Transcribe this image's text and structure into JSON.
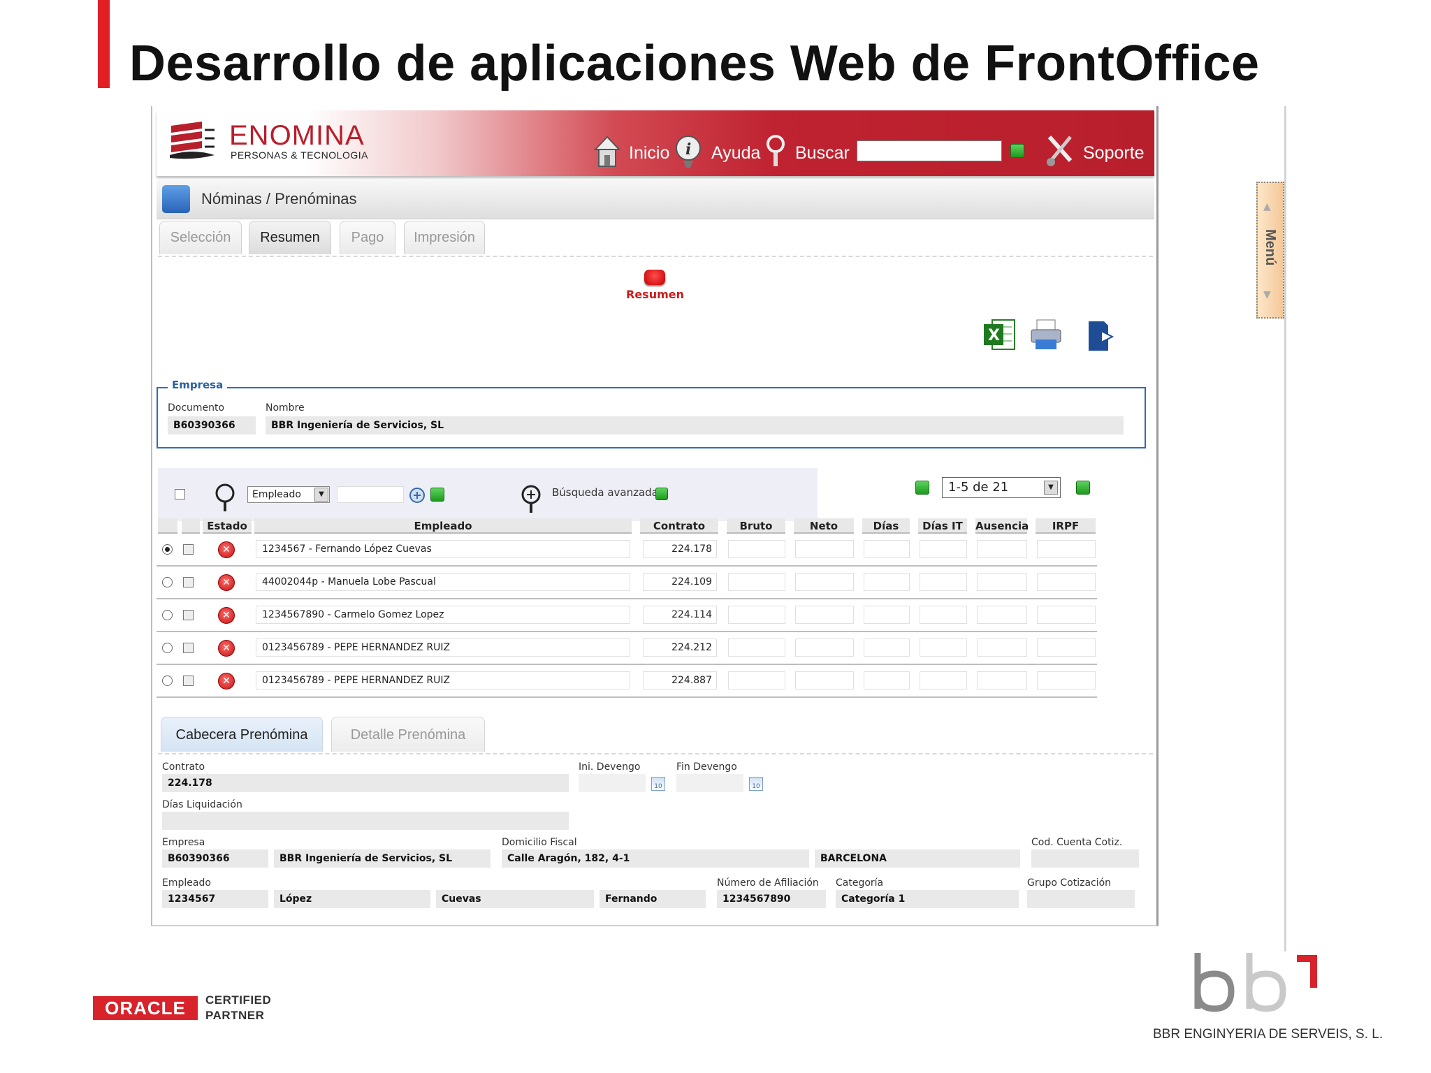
{
  "slide": {
    "title": "Desarrollo de aplicaciones Web de FrontOffice"
  },
  "brand": {
    "name": "ENOMINA",
    "tagline": "PERSONAS & TECNOLOGIA"
  },
  "nav": {
    "inicio": "Inicio",
    "ayuda": "Ayuda",
    "buscar": "Buscar",
    "soporte": "Soporte",
    "search_value": ""
  },
  "breadcrumb": "Nóminas / Prenóminas",
  "tabs": [
    {
      "label": "Selección"
    },
    {
      "label": "Resumen",
      "active": true
    },
    {
      "label": "Pago"
    },
    {
      "label": "Impresión"
    }
  ],
  "summary": {
    "label": "Resumen"
  },
  "toolbar_icons": [
    "excel-icon",
    "print-icon",
    "export-icon"
  ],
  "empresa": {
    "legend": "Empresa",
    "documento_label": "Documento",
    "documento": "B60390366",
    "nombre_label": "Nombre",
    "nombre": "BBR Ingeniería de Servicios, SL"
  },
  "search": {
    "field": "Empleado",
    "value": "",
    "advanced_label": "Búsqueda avanzada"
  },
  "pager": {
    "label": "1-5 de 21"
  },
  "table": {
    "headers": [
      "Estado",
      "Empleado",
      "Contrato",
      "Bruto",
      "Neto",
      "Días",
      "Días IT",
      "Ausencia",
      "IRPF"
    ],
    "rows": [
      {
        "selected": true,
        "empleado": "1234567 - Fernando López Cuevas",
        "contrato": "224.178"
      },
      {
        "selected": false,
        "empleado": "44002044p - Manuela Lobe  Pascual",
        "contrato": "224.109"
      },
      {
        "selected": false,
        "empleado": "1234567890 - Carmelo Gomez Lopez",
        "contrato": "224.114"
      },
      {
        "selected": false,
        "empleado": "0123456789 - PEPE HERNANDEZ RUIZ",
        "contrato": "224.212"
      },
      {
        "selected": false,
        "empleado": "0123456789 - PEPE HERNANDEZ RUIZ",
        "contrato": "224.887"
      }
    ]
  },
  "bottom_tabs": [
    {
      "label": "Cabecera Prenómina",
      "active": true
    },
    {
      "label": "Detalle Prenómina"
    }
  ],
  "cabecera": {
    "contrato_label": "Contrato",
    "contrato": "224.178",
    "ini_devengo_label": "Ini. Devengo",
    "ini_devengo": "",
    "fin_devengo_label": "Fin Devengo",
    "fin_devengo": "",
    "dias_liquidacion_label": "Días Liquidación",
    "dias_liquidacion": "",
    "empresa_label": "Empresa",
    "empresa_cif": "B60390366",
    "empresa_nombre": "BBR Ingeniería de Servicios, SL",
    "domicilio_label": "Domicilio Fiscal",
    "domicilio": "Calle Aragón, 182, 4-1",
    "ciudad": "BARCELONA",
    "cod_cuenta_label": "Cod. Cuenta Cotiz.",
    "cod_cuenta": "",
    "empleado_label": "Empleado",
    "empleado_id": "1234567",
    "apellido1": "López",
    "apellido2": "Cuevas",
    "nombre": "Fernando",
    "afiliacion_label": "Número de Afiliación",
    "afiliacion": "1234567890",
    "categoria_label": "Categoría",
    "categoria": "Categoría 1",
    "grupo_label": "Grupo Cotización",
    "grupo": ""
  },
  "side_menu": {
    "label": "Menú"
  },
  "footer": {
    "oracle": "ORACLE",
    "certified": "CERTIFIED",
    "partner": "PARTNER",
    "company": "BBR ENGINYERIA DE SERVEIS, S. L."
  },
  "colors": {
    "accent": "#e31f26",
    "brand_red": "#b81f2c",
    "panel_blue": "#2f6db5"
  }
}
